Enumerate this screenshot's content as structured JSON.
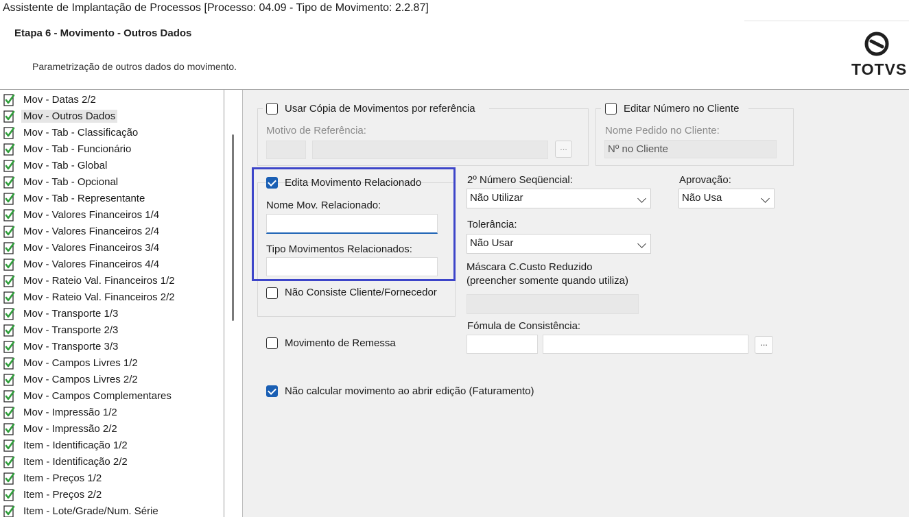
{
  "window": {
    "title": "Assistente de Implantação de Processos [Processo: 04.09 - Tipo de Movimento: 2.2.87]"
  },
  "header": {
    "step_title": "Etapa 6 - Movimento - Outros Dados",
    "step_desc": "Parametrização de outros dados do movimento.",
    "logo_text": "TOTVS"
  },
  "tree": {
    "selected_index": 1,
    "items": [
      "Mov - Datas 2/2",
      "Mov - Outros Dados",
      "Mov - Tab - Classificação",
      "Mov - Tab - Funcionário",
      "Mov - Tab - Global",
      "Mov - Tab - Opcional",
      "Mov - Tab - Representante",
      "Mov - Valores Financeiros 1/4",
      "Mov - Valores Financeiros 2/4",
      "Mov - Valores Financeiros 3/4",
      "Mov - Valores Financeiros 4/4",
      "Mov - Rateio Val. Financeiros 1/2",
      "Mov - Rateio Val. Financeiros 2/2",
      "Mov - Transporte 1/3",
      "Mov - Transporte 2/3",
      "Mov - Transporte 3/3",
      "Mov - Campos Livres 1/2",
      "Mov - Campos Livres 2/2",
      "Mov - Campos Complementares",
      "Mov - Impressão 1/2",
      "Mov - Impressão 2/2",
      "Item - Identificação 1/2",
      "Item - Identificação 2/2",
      "Item - Preços 1/2",
      "Item - Preços 2/2",
      "Item - Lote/Grade/Num. Série"
    ]
  },
  "form": {
    "copia": {
      "label": "Usar Cópia de Movimentos por referência",
      "checked": false,
      "motivo_label": "Motivo de Referência:",
      "browse": "..."
    },
    "editar_numero": {
      "label": "Editar Número no Cliente",
      "checked": false,
      "nome_pedido_label": "Nome Pedido no Cliente:",
      "nome_pedido_value": "Nº no Cliente"
    },
    "edita_relacionado": {
      "label": "Edita Movimento Relacionado",
      "checked": true,
      "nome_label": "Nome Mov. Relacionado:",
      "nome_value": "",
      "tipo_label": "Tipo Movimentos Relacionados:",
      "tipo_value": ""
    },
    "nao_consiste": {
      "label": "Não Consiste Cliente/Fornecedor",
      "checked": false
    },
    "remessa": {
      "label": "Movimento de Remessa",
      "checked": false
    },
    "nao_calcular": {
      "label": "Não calcular movimento ao abrir edição (Faturamento)",
      "checked": true
    },
    "segundo_numero": {
      "label": "2º Número Seqüencial:",
      "value": "Não Utilizar"
    },
    "aprovacao": {
      "label": "Aprovação:",
      "value": "Não Usa"
    },
    "tolerancia": {
      "label": "Tolerância:",
      "value": "Não Usar"
    },
    "mascara": {
      "label1": "Máscara C.Custo Reduzido",
      "label2": "(preencher somente quando utiliza)"
    },
    "formula": {
      "label": "Fómula de Consistência:",
      "browse": "..."
    }
  },
  "colors": {
    "accent": "#1a5fb4",
    "highlight": "#3d45c9",
    "panel_bg": "#f0f0f0"
  }
}
